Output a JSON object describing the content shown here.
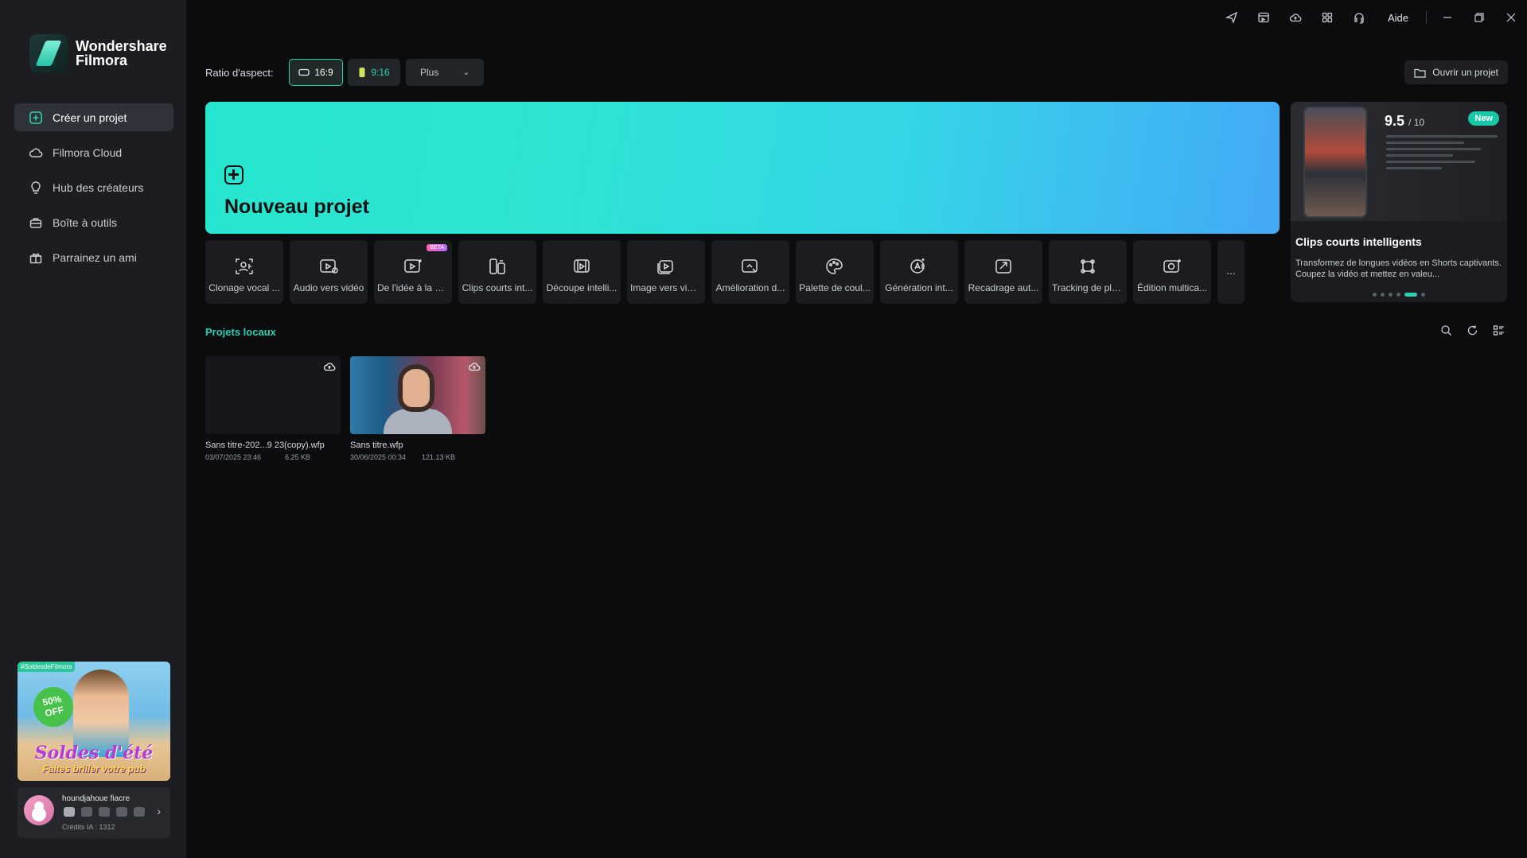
{
  "app": {
    "brand_line1": "Wondershare",
    "brand_line2": "Filmora"
  },
  "sidebar": {
    "items": [
      {
        "label": "Créer un projet",
        "icon": "plus-square-icon",
        "active": true
      },
      {
        "label": "Filmora Cloud",
        "icon": "cloud-icon",
        "active": false
      },
      {
        "label": "Hub des créateurs",
        "icon": "bulb-icon",
        "active": false
      },
      {
        "label": "Boîte à outils",
        "icon": "toolbox-icon",
        "active": false
      },
      {
        "label": "Parrainez un ami",
        "icon": "gift-icon",
        "active": false
      }
    ],
    "promo": {
      "tag": "#SoldesdeFilmora",
      "badge_line1": "50%",
      "badge_line2": "OFF",
      "title": "Soldes d'été",
      "subtitle": "Faites briller votre pub"
    },
    "user": {
      "name": "houndjahoue fiacre",
      "credits": "Crédits IA : 1312"
    }
  },
  "titlebar": {
    "help_label": "Aide",
    "icons": [
      "send-icon",
      "media-icon",
      "cloud-upload-icon",
      "apps-grid-icon",
      "headset-icon"
    ],
    "window_controls": [
      "minimize-icon",
      "restore-icon",
      "close-icon"
    ]
  },
  "aspect": {
    "label": "Ratio d'aspect:",
    "options": [
      "16:9",
      "9:16"
    ],
    "selected": "16:9",
    "more_label": "Plus"
  },
  "open_project_label": "Ouvrir un projet",
  "new_project_label": "Nouveau projet",
  "features": [
    {
      "label": "Clonage vocal ...",
      "icon": "voice-clone-icon"
    },
    {
      "label": "Audio vers vidéo",
      "icon": "audio-to-video-icon"
    },
    {
      "label": "De l'idée à la vi...",
      "icon": "idea-to-video-icon",
      "badge": "BETA"
    },
    {
      "label": "Clips courts int...",
      "icon": "short-clips-icon"
    },
    {
      "label": "Découpe intelli...",
      "icon": "smart-cut-icon"
    },
    {
      "label": "Image vers vidéo",
      "icon": "image-to-video-icon"
    },
    {
      "label": "Amélioration d...",
      "icon": "enhance-icon"
    },
    {
      "label": "Palette de coul...",
      "icon": "color-palette-icon"
    },
    {
      "label": "Génération int...",
      "icon": "ai-generation-icon"
    },
    {
      "label": "Recadrage aut...",
      "icon": "auto-reframe-icon"
    },
    {
      "label": "Tracking de plans",
      "icon": "tracking-icon"
    },
    {
      "label": "Édition multica...",
      "icon": "multicam-icon"
    }
  ],
  "more_features_label": "...",
  "side_card": {
    "score": "9.5",
    "score_max": "/ 10",
    "new_badge": "New",
    "title": "Clips courts intelligents",
    "description": "Transformez de longues vidéos en Shorts captivants. Coupez la vidéo et mettez en valeu..."
  },
  "local_projects": {
    "title": "Projets locaux",
    "items": [
      {
        "name": "Sans titre-202...9 23(copy).wfp",
        "date": "03/07/2025 23:46",
        "size": "6.25 KB"
      },
      {
        "name": "Sans titre.wfp",
        "date": "30/06/2025 00:34",
        "size": "121.13 KB"
      }
    ]
  }
}
